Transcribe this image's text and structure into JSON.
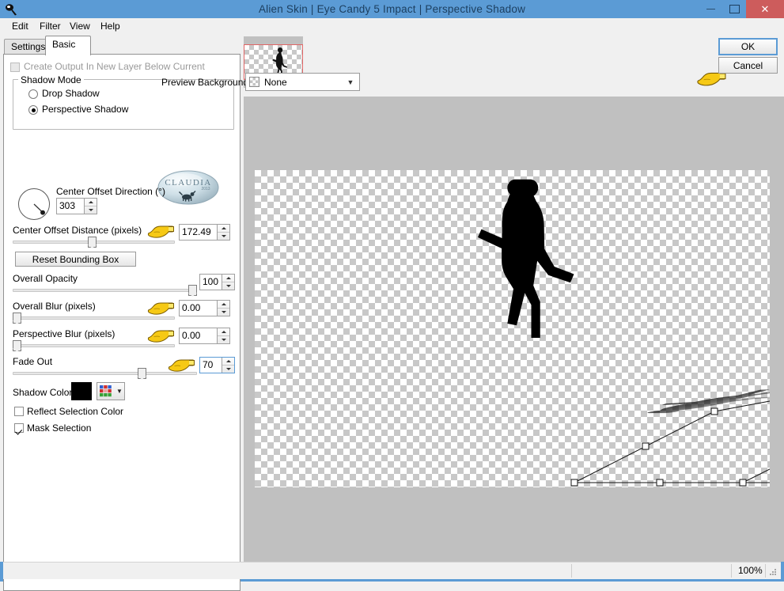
{
  "window": {
    "title": "Alien Skin | Eye Candy 5 Impact | Perspective Shadow",
    "icon": "app-icon",
    "minimize": "–",
    "maximize": "□",
    "close": "✕"
  },
  "menubar": {
    "items": [
      "Edit",
      "Filter",
      "View",
      "Help"
    ]
  },
  "tabs": [
    {
      "label": "Settings",
      "active": false
    },
    {
      "label": "Basic",
      "active": true
    }
  ],
  "panel": {
    "create_output_label": "Create Output In New Layer Below Current",
    "shadow_mode": {
      "title": "Shadow Mode",
      "options": [
        "Drop Shadow",
        "Perspective Shadow"
      ],
      "selected": "Perspective Shadow"
    },
    "center_offset_direction": {
      "label": "Center Offset Direction (°)",
      "value": "303"
    },
    "center_offset_distance": {
      "label": "Center Offset Distance (pixels)",
      "value": "172.49"
    },
    "reset_bounding_box": "Reset Bounding Box",
    "overall_opacity": {
      "label": "Overall Opacity",
      "value": "100"
    },
    "overall_blur": {
      "label": "Overall Blur (pixels)",
      "value": "0.00"
    },
    "perspective_blur": {
      "label": "Perspective Blur (pixels)",
      "value": "0.00"
    },
    "fade_out": {
      "label": "Fade Out",
      "value": "70"
    },
    "shadow_color": {
      "label": "Shadow Color",
      "color": "#000000"
    },
    "reflect_selection_color": {
      "label": "Reflect Selection Color",
      "checked": false
    },
    "mask_selection": {
      "label": "Mask Selection",
      "checked": true
    }
  },
  "watermark": {
    "text": "CLAUDIA",
    "sub": "2013"
  },
  "preview": {
    "tools": [
      "eyedropper-icon",
      "hand-icon",
      "zoom-icon",
      "arrow-select-icon"
    ],
    "selected_tool": "arrow-select-icon",
    "background_label": "Preview Background:",
    "background_value": "None"
  },
  "actions": {
    "ok": "OK",
    "cancel": "Cancel"
  },
  "statusbar": {
    "zoom": "100%"
  },
  "colors": {
    "titlebar": "#5b9bd5",
    "close_button": "#cd5c5c",
    "accent": "#5b9bd5",
    "panel_bg": "#ffffff",
    "canvas_bg": "#c0c0c0",
    "thumb_border": "#e06666"
  }
}
